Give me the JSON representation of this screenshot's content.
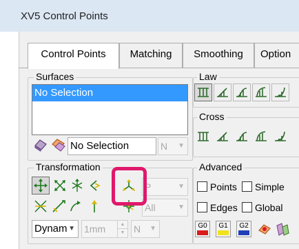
{
  "window": {
    "title": "XV5 Control Points"
  },
  "tabs": [
    {
      "label": "Control Points",
      "active": true
    },
    {
      "label": "Matching",
      "active": false
    },
    {
      "label": "Smoothing",
      "active": false
    },
    {
      "label": "Option",
      "active": false
    }
  ],
  "surfaces": {
    "legend": "Surfaces",
    "list_selected": "No Selection",
    "selection_field": "No Selection",
    "selection_combo": "N"
  },
  "law": {
    "legend": "Law"
  },
  "cross": {
    "legend": "Cross"
  },
  "transformation": {
    "legend": "Transformation",
    "combo_top": "P",
    "combo_mid": "All",
    "mode_combo": "Dynam",
    "step_field": "1mm",
    "step_combo": "N"
  },
  "advanced": {
    "legend": "Advanced",
    "points_label": "Points",
    "simple_label": "Simple",
    "edges_label": "Edges",
    "global_label": "Global",
    "continuity_buttons": [
      {
        "label": "G0",
        "color": "#d81c1c"
      },
      {
        "label": "G1",
        "color": "#f2e21b"
      },
      {
        "label": "G2",
        "color": "#1f3fb8"
      }
    ]
  },
  "colors": {
    "titlebar": "#dbe7f3",
    "panel": "#f0f0f0",
    "selection": "#3399ff",
    "highlight": "#e0186b"
  }
}
